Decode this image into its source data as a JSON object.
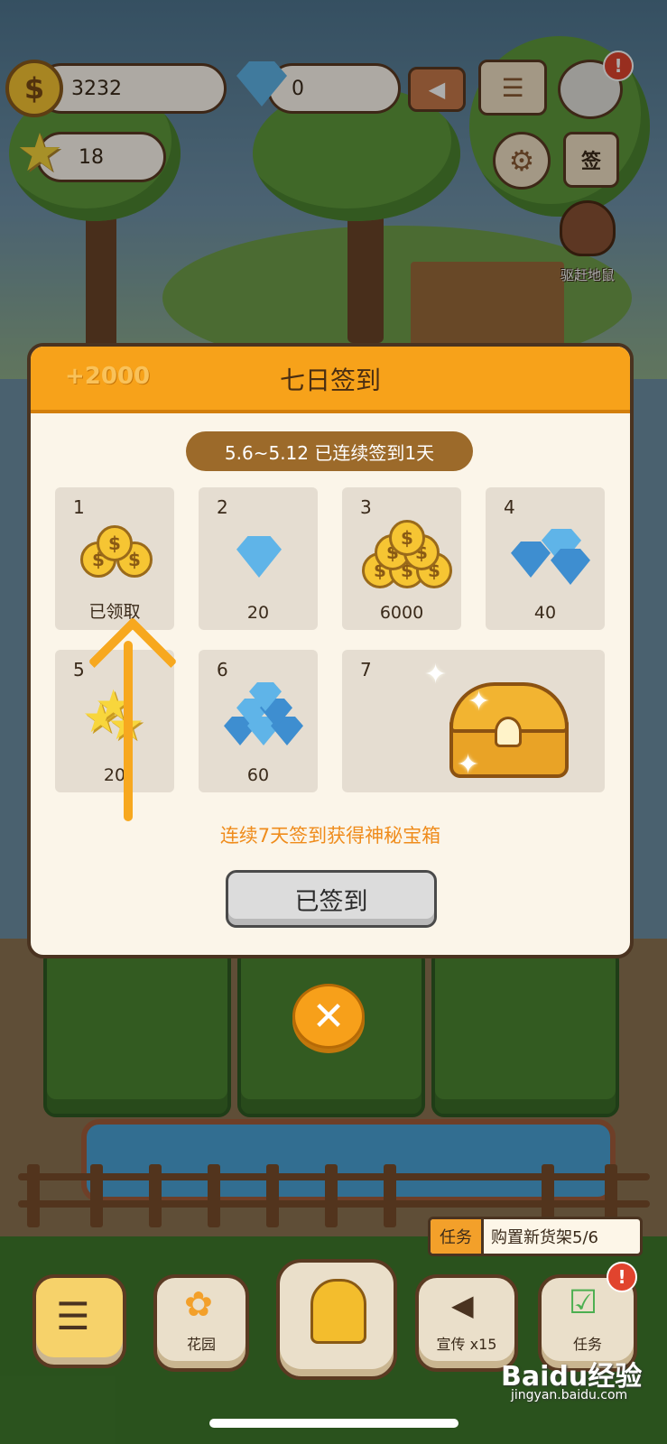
{
  "hud": {
    "coins": "3232",
    "gems": "0",
    "stars": "18",
    "sign_button": "签",
    "mole_label": "驱赶地鼠",
    "alert": "!"
  },
  "dialog": {
    "bonus": "+2000",
    "title": "七日签到",
    "range": "5.6~5.12 已连续签到1天",
    "days": [
      {
        "num": "1",
        "value": "已领取",
        "reward": "coins"
      },
      {
        "num": "2",
        "value": "20",
        "reward": "gem"
      },
      {
        "num": "3",
        "value": "6000",
        "reward": "coins"
      },
      {
        "num": "4",
        "value": "40",
        "reward": "gems"
      },
      {
        "num": "5",
        "value": "20",
        "reward": "stars"
      },
      {
        "num": "6",
        "value": "60",
        "reward": "gems"
      },
      {
        "num": "7",
        "value": "",
        "reward": "chest"
      }
    ],
    "promo": "连续7天签到获得神秘宝箱",
    "signed_button": "已签到",
    "close_symbol": "✕"
  },
  "task": {
    "tag": "任务",
    "text": "购置新货架5/6"
  },
  "nav": {
    "garden": "花园",
    "promote": "宣传 x15",
    "tasks": "任务"
  },
  "watermark": {
    "main": "Baidu经验",
    "sub": "jingyan.baidu.com"
  },
  "colors": {
    "header_orange": "#f7a21a",
    "promo_orange": "#ef8c1c",
    "range_brown": "#9c6a2a",
    "cell_bg": "#e5ddd1"
  }
}
